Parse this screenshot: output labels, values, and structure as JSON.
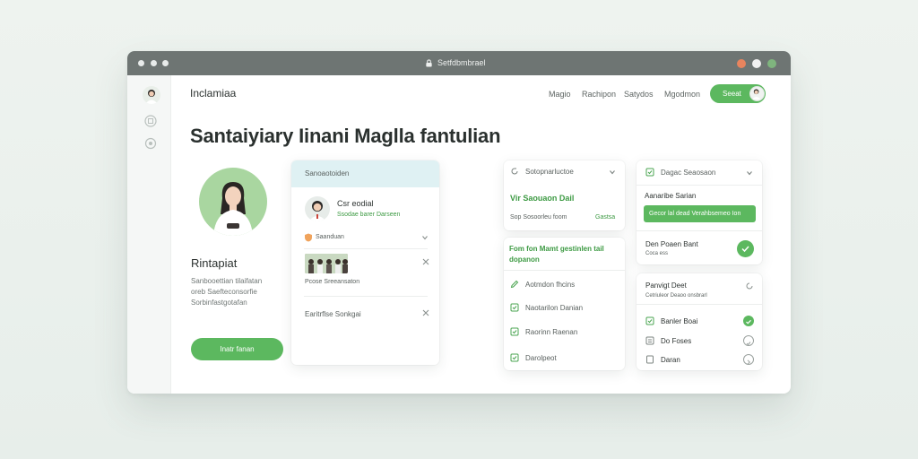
{
  "window": {
    "url": "Setfdbmbrael"
  },
  "colors": {
    "accent": "#5cb85f",
    "titlebar": "#6e7573",
    "banner": "#dff1f3",
    "close": "#e8845e",
    "minimize": "#f1f1f1",
    "maximize": "#7fb57e"
  },
  "header": {
    "brand": "Inclamiaa",
    "nav": [
      "Magio",
      "Rachipon",
      "Satydos",
      "Mgodmon"
    ],
    "cta": "Seeat"
  },
  "headline": "Santaiyiary Iinani Maglla fantulian",
  "profile": {
    "name": "Rintapiat",
    "description": [
      "Sanbooettian tilaifatan",
      "oreb Saefteconsorfie",
      "Sorbinfastgotafan"
    ],
    "button": "Inatr fanan"
  },
  "feed_card": {
    "banner": "Sanoaotoiden",
    "person_name": "Csr eodial",
    "person_sub": "Ssodae barer Darseen",
    "rows": [
      {
        "label": "Saanduan"
      },
      {
        "label": "Pcose Sreeansaton"
      },
      {
        "label": "Earitrflse Sonkgai"
      }
    ]
  },
  "checklist_card": {
    "header": "Sotopnarluctoe",
    "title": "Vir Saouaon Dail",
    "meta_left": "Sop Sosoorleu foom",
    "meta_right": "Gastsa"
  },
  "tasks_card": {
    "title": "Fom fon Mamt gestinlen tail dopanon",
    "items": [
      "Aotmdon fhcins",
      "Naotarilon Danian",
      "Raorinn Raenan",
      "Darolpeot"
    ]
  },
  "right_top_card": {
    "header": "Dagac Seaosaon",
    "title": "Aanaribe Sarian",
    "bar": "Gecor lal dead Verahbsemeo Ion",
    "row": "Den Poaen Bant",
    "row_sub": "Coca ess"
  },
  "right_bottom_card": {
    "header": "Panvigt Deet",
    "sub": "Cetriuleor Deaoo onsbrarl",
    "items": [
      "Banler Boai",
      "Do Foses",
      "Daran"
    ]
  },
  "icons": {
    "lock": "lock-icon",
    "close": "close-icon",
    "check": "check-icon",
    "chevron": "chevron-down-icon",
    "grid": "grid-icon",
    "help": "help-icon"
  }
}
